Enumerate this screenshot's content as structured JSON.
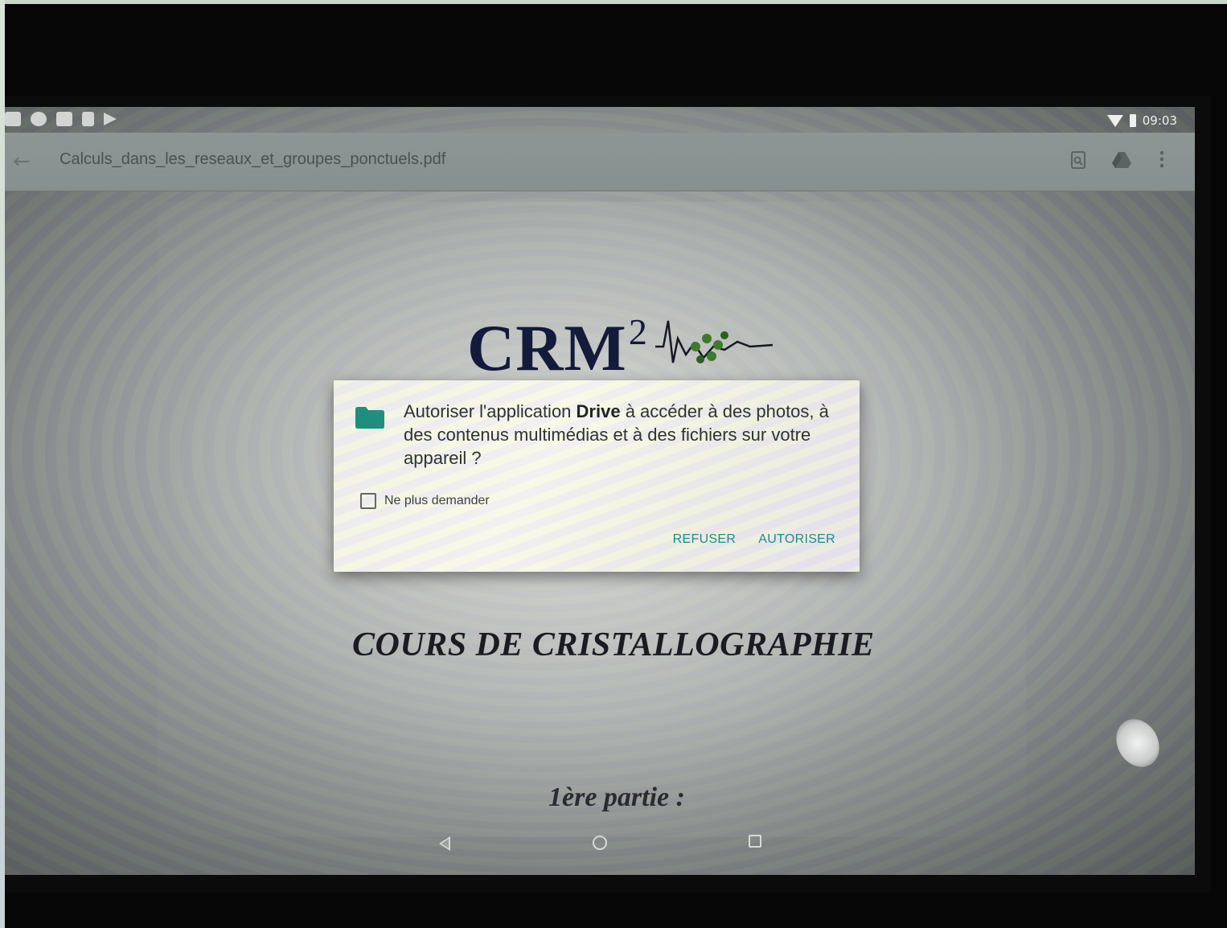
{
  "status_bar": {
    "time": "09:03",
    "notification_icons": [
      "mail-icon",
      "cloud-icon",
      "square-icon",
      "sd-card-icon",
      "play-store-icon"
    ],
    "status_icons": [
      "wifi-icon",
      "battery-icon"
    ]
  },
  "toolbar": {
    "back_icon": "arrow-back-icon",
    "title": "Calculs_dans_les_reseaux_et_groupes_ponctuels.pdf",
    "action_icons": [
      "document-details-icon",
      "add-to-drive-icon",
      "more-vert-icon"
    ]
  },
  "pdf": {
    "logo_text": "CRM",
    "logo_superscript": "2",
    "course_title": "COURS DE CRISTALLOGRAPHIE",
    "part_label": "1ère partie :"
  },
  "dialog": {
    "icon": "folder-icon",
    "message_prefix": "Autoriser l'application ",
    "app_name": "Drive",
    "message_suffix": " à accéder à des photos, à des contenus multimédias et à des fichiers sur votre appareil ?",
    "checkbox_label": "Ne plus demander",
    "checkbox_checked": false,
    "deny_label": "REFUSER",
    "allow_label": "AUTORISER",
    "accent_color": "#1d8d8a",
    "folder_color": "#1e8f7e"
  },
  "nav_bar": {
    "icons": [
      "nav-back-icon",
      "nav-home-icon",
      "nav-recents-icon"
    ]
  }
}
